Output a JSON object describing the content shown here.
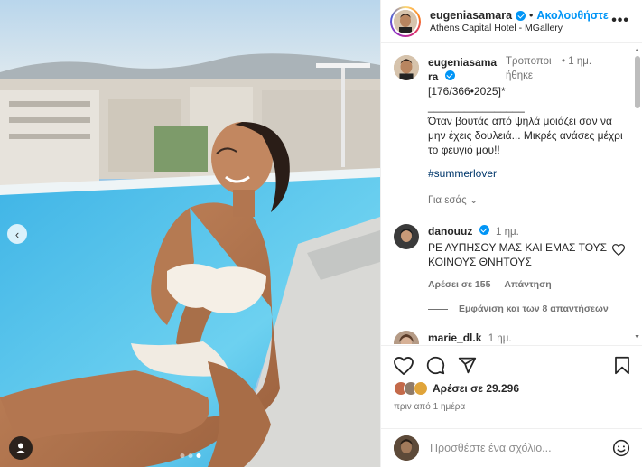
{
  "post": {
    "username": "eugeniasamara",
    "follow_label": "Ακολουθήστε",
    "location": "Athens Capital Hotel - MGallery",
    "more_icon": "•••"
  },
  "caption": {
    "username": "eugeniasamara",
    "edited": "Τροποποιήθηκε",
    "time": "1 ημ.",
    "text": "[176/366•2025]*\n________________\nΌταν βουτάς από ψηλά μοιάζει σαν να μην έχεις δουλειά... Μικρές ανάσες μέχρι το φευγιό μου!!",
    "hashtag": "#summerlover",
    "translate": "Για εσάς"
  },
  "comments": [
    {
      "username": "danouuz",
      "time": "1 ημ.",
      "text": "ΡΕ ΛΥΠΗΣΟΥ ΜΑΣ ΚΑΙ ΕΜΑΣ ΤΟΥΣ ΚΟΙΝΟΥΣ ΘΝΗΤΟΥΣ",
      "likes": "Αρέσει σε 155",
      "reply": "Απάντηση",
      "view_replies": "Εμφάνιση και των 8 απαντήσεων"
    },
    {
      "username": "marie_dl.k",
      "time": "1 ημ."
    }
  ],
  "likes": {
    "text": "Αρέσει σε 29.296"
  },
  "time_ago": "πριν από 1 ημέρα",
  "add_comment": {
    "placeholder": "Προσθέστε ένα σχόλιο..."
  },
  "colors": {
    "accent": "#0095f6",
    "text": "#262626",
    "muted": "#737373"
  }
}
